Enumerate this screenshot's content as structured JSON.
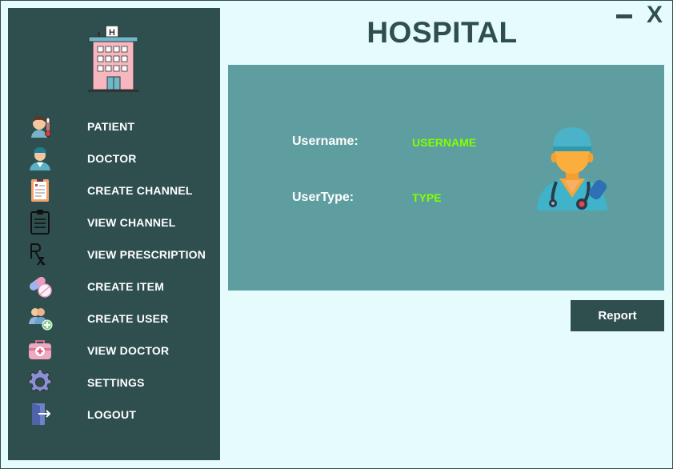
{
  "app": {
    "title": "HOSPITAL",
    "window_controls": {
      "minimize_icon": "minimize-icon",
      "close_label": "X"
    }
  },
  "sidebar": {
    "logo_icon": "hospital-building-icon",
    "logo_sign": "H",
    "items": [
      {
        "label": "PATIENT",
        "icon": "patient-icon"
      },
      {
        "label": "DOCTOR",
        "icon": "doctor-icon"
      },
      {
        "label": "CREATE CHANNEL",
        "icon": "clipboard-medical-icon"
      },
      {
        "label": "VIEW CHANNEL",
        "icon": "clipboard-list-icon"
      },
      {
        "label": "VIEW PRESCRIPTION",
        "icon": "rx-icon"
      },
      {
        "label": "CREATE ITEM",
        "icon": "pills-icon"
      },
      {
        "label": "CREATE USER",
        "icon": "add-user-icon"
      },
      {
        "label": "VIEW DOCTOR",
        "icon": "medical-kit-icon"
      },
      {
        "label": "SETTINGS",
        "icon": "gear-icon"
      },
      {
        "label": "LOGOUT",
        "icon": "logout-icon"
      }
    ],
    "rx_text": "Rx"
  },
  "main": {
    "username_label": "Username:",
    "username_value": "USERNAME",
    "usertype_label": "UserType:",
    "usertype_value": "TYPE",
    "avatar_icon": "doctor-avatar-icon",
    "report_button": "Report"
  },
  "colors": {
    "sidebar_bg": "#2f4f4f",
    "page_bg": "#e6fbfb",
    "panel_bg": "#5f9ea0",
    "value_text": "#7fff00",
    "title_text": "#2f4f4f"
  }
}
